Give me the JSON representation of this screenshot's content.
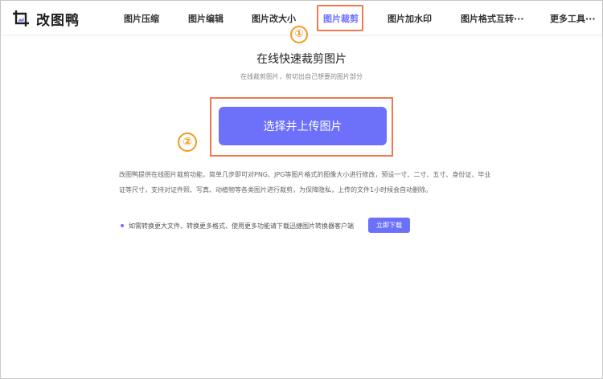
{
  "brand": {
    "name": "改图鸭"
  },
  "nav": {
    "items": [
      {
        "label": "图片压缩"
      },
      {
        "label": "图片编辑"
      },
      {
        "label": "图片改大小"
      },
      {
        "label": "图片裁剪"
      },
      {
        "label": "图片加水印"
      },
      {
        "label": "图片格式互转···"
      },
      {
        "label": "更多工具···"
      }
    ],
    "active_index": 3
  },
  "markers": {
    "one": "①",
    "two": "②"
  },
  "main": {
    "title": "在线快速裁剪图片",
    "subtitle": "在线裁剪图片，剪切出自己想要的图片部分",
    "upload_label": "选择并上传图片",
    "description": "改图鸭提供在线图片裁剪功能，简单几步即可对PNG、JPG等图片格式的图像大小进行修改，预设一寸、二寸、五寸、身份证、毕业证等尺寸，支持对证件照、写真、动植物等各类图片进行裁剪，为保障隐私，上传的文件1小时候会自动删除。",
    "notice": "如需转换更大文件、转换更多格式、使用更多功能请下载迅捷图片转换器客户端",
    "download_label": "立即下载"
  },
  "colors": {
    "accent": "#6d71f9",
    "highlight": "#f0794f",
    "marker": "#f29a1f"
  }
}
